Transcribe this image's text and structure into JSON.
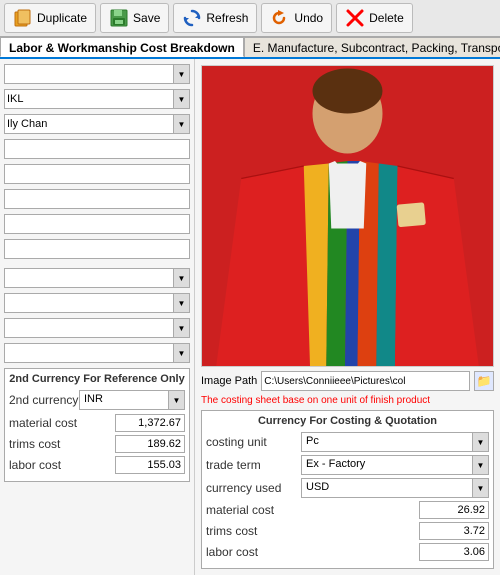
{
  "toolbar": {
    "duplicate_label": "Duplicate",
    "save_label": "Save",
    "refresh_label": "Refresh",
    "undo_label": "Undo",
    "delete_label": "Delete"
  },
  "tabs": {
    "tab1_label": "Labor & Workmanship Cost Breakdown",
    "tab2_label": "E. Manufacture, Subcontract, Packing, Transport, ..."
  },
  "left_fields": {
    "field1_value": "",
    "field2_value": "IKL",
    "field3_value": "Ily Chan",
    "field4_value": "",
    "field5_value": "",
    "field6_value": "",
    "field7_value": "",
    "field8_value": "",
    "field9_value": "",
    "field10_value": "",
    "field11_value": "",
    "field12_value": ""
  },
  "image_path": {
    "label": "Image Path",
    "value": "C:\\Users\\Conniieee\\Pictures\\col"
  },
  "warning": {
    "text": "The costing sheet base on one unit of finish product"
  },
  "second_currency": {
    "title": "2nd Currency For Reference Only",
    "currency_label": "2nd currency",
    "currency_value": "INR",
    "material_cost_label": "material cost",
    "material_cost_value": "1,372.67",
    "trims_cost_label": "trims cost",
    "trims_cost_value": "189.62",
    "labor_cost_label": "labor cost",
    "labor_cost_value": "155.03"
  },
  "costing_currency": {
    "title": "Currency For Costing & Quotation",
    "costing_unit_label": "costing unit",
    "costing_unit_value": "Pc",
    "trade_term_label": "trade term",
    "trade_term_value": "Ex - Factory",
    "currency_used_label": "currency used",
    "currency_used_value": "USD",
    "material_cost_label": "material cost",
    "material_cost_value": "26.92",
    "trims_cost_label": "trims cost",
    "trims_cost_value": "3.72",
    "labor_cost_label": "labor cost",
    "labor_cost_value": "3.06"
  }
}
